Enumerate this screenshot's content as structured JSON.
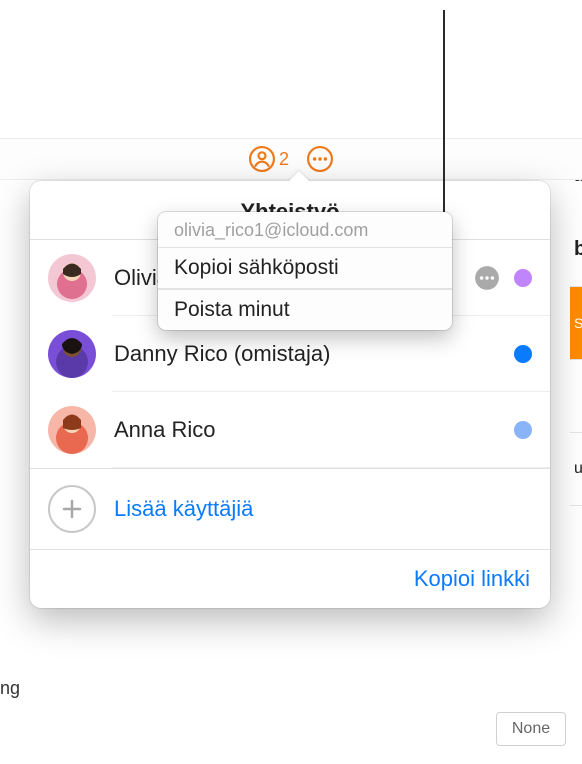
{
  "toolbar": {
    "share_count": "2"
  },
  "popover": {
    "title": "Yhteistyö",
    "users": [
      {
        "name": "Olivia Rico",
        "display": "Olivia Rico",
        "color": "#c084fc"
      },
      {
        "name": "Danny Rico (omistaja)",
        "display": "Danny Rico (omistaja)",
        "color": "#0a7aff"
      },
      {
        "name": "Anna Rico",
        "display": "Anna Rico",
        "color": "#8ab4f8"
      }
    ],
    "add_label": "Lisää käyttäjiä",
    "footer_link": "Kopioi linkki"
  },
  "context_menu": {
    "email": "olivia_rico1@icloud.com",
    "copy_email": "Kopioi sähköposti",
    "remove_me": "Poista minut"
  },
  "background": {
    "right_letters": [
      "ar",
      "b",
      "S",
      "",
      "u",
      ""
    ],
    "none_label": "None",
    "edge_ng": "ng"
  },
  "colors": {
    "accent": "#ef7a1a",
    "link": "#0a7aff"
  }
}
